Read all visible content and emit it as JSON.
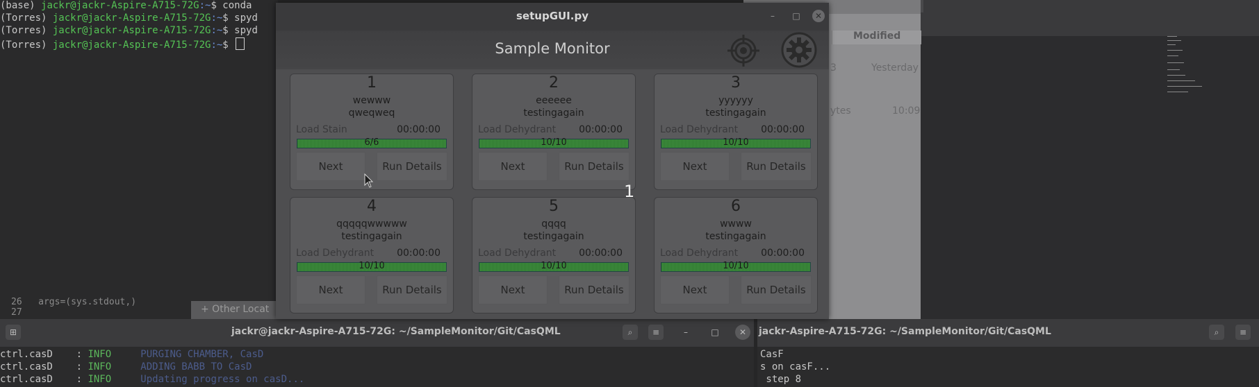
{
  "terminal_top": {
    "lines": [
      {
        "prefix": "(base) ",
        "user": "jackr@jackr-Aspire-A715-72G",
        "cwd": ":~",
        "cmd": "$ conda"
      },
      {
        "prefix": "(Torres) ",
        "user": "jackr@jackr-Aspire-A715-72G",
        "cwd": ":~",
        "cmd": "$ spyd"
      },
      {
        "prefix": "(Torres) ",
        "user": "jackr@jackr-Aspire-A715-72G",
        "cwd": ":~",
        "cmd": "$ spyd"
      },
      {
        "prefix": "(Torres) ",
        "user": "jackr@jackr-Aspire-A715-72G",
        "cwd": ":~",
        "cmd": "$ "
      }
    ]
  },
  "editor": {
    "line26_num": "26",
    "line26_code": "args=(sys.stdout,)",
    "line27_num": "27"
  },
  "file_manager": {
    "col_modified": "Modified",
    "row1_size": "3",
    "row1_modified": "Yesterday",
    "row2_size": "ytes",
    "row2_modified": "10:09",
    "other_locations": "+ Other Locat"
  },
  "bottom_terminals": [
    {
      "title": "jackr@jackr-Aspire-A715-72G: ~/SampleMonitor/Git/CasQML",
      "lines": [
        {
          "src": "ctrl.casD    : ",
          "lvl": "INFO",
          "msg": "     PURGING CHAMBER, CasD"
        },
        {
          "src": "ctrl.casD    : ",
          "lvl": "INFO",
          "msg": "     ADDING BABB TO CasD"
        },
        {
          "src": "ctrl.casD    : ",
          "lvl": "INFO",
          "msg": "     Updating progress on casD..."
        }
      ]
    },
    {
      "title": "jackr-Aspire-A715-72G: ~/SampleMonitor/Git/CasQML",
      "lines": [
        {
          "text": "CasF"
        },
        {
          "text": "s on casF..."
        },
        {
          "text": " step 8"
        }
      ]
    }
  ],
  "app": {
    "window_title": "setupGUI.py",
    "header_title": "Sample Monitor",
    "overlay_number": "1",
    "samples": [
      {
        "num": "1",
        "name": "wewww",
        "desc": "qweqweq",
        "step": "Load Stain",
        "time": "00:00:00",
        "progress_text": "6/6",
        "progress": 1.0,
        "next_label": "Next",
        "run_label": "Run Details"
      },
      {
        "num": "2",
        "name": "eeeeee",
        "desc": "testingagain",
        "step": "Load Dehydrant",
        "time": "00:00:00",
        "progress_text": "10/10",
        "progress": 1.0,
        "next_label": "Next",
        "run_label": "Run Details"
      },
      {
        "num": "3",
        "name": "yyyyyy",
        "desc": "testingagain",
        "step": "Load Dehydrant",
        "time": "00:00:00",
        "progress_text": "10/10",
        "progress": 1.0,
        "next_label": "Next",
        "run_label": "Run Details"
      },
      {
        "num": "4",
        "name": "qqqqqwwwww",
        "desc": "testingagain",
        "step": "Load Dehydrant",
        "time": "00:00:00",
        "progress_text": "10/10",
        "progress": 1.0,
        "next_label": "Next",
        "run_label": "Run Details"
      },
      {
        "num": "5",
        "name": "qqqq",
        "desc": "testingagain",
        "step": "Load Dehydrant",
        "time": "00:00:00",
        "progress_text": "10/10",
        "progress": 1.0,
        "next_label": "Next",
        "run_label": "Run Details"
      },
      {
        "num": "6",
        "name": "wwww",
        "desc": "testingagain",
        "step": "Load Dehydrant",
        "time": "00:00:00",
        "progress_text": "10/10",
        "progress": 1.0,
        "next_label": "Next",
        "run_label": "Run Details"
      }
    ]
  }
}
